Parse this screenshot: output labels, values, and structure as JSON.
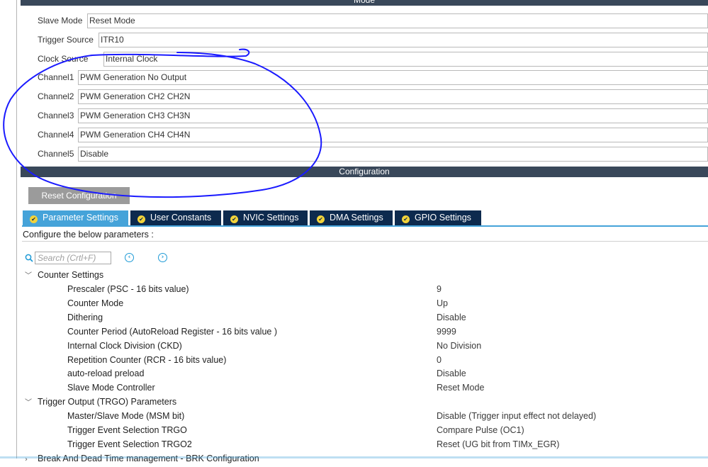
{
  "mode": {
    "header": "Mode",
    "rows": [
      {
        "label": "Slave Mode",
        "value": "Reset Mode"
      },
      {
        "label": "Trigger Source",
        "value": "ITR10"
      },
      {
        "label": "Clock Source",
        "value": "Internal Clock"
      },
      {
        "label": "Channel1",
        "value": "PWM Generation No Output"
      },
      {
        "label": "Channel2",
        "value": "PWM Generation CH2 CH2N"
      },
      {
        "label": "Channel3",
        "value": "PWM Generation CH3 CH3N"
      },
      {
        "label": "Channel4",
        "value": "PWM Generation CH4 CH4N"
      },
      {
        "label": "Channel5",
        "value": "Disable"
      }
    ]
  },
  "configuration": {
    "header": "Configuration",
    "reset_button": "Reset Configuration",
    "tabs": [
      {
        "label": "Parameter Settings",
        "active": true
      },
      {
        "label": "User Constants",
        "active": false
      },
      {
        "label": "NVIC Settings",
        "active": false
      },
      {
        "label": "DMA Settings",
        "active": false
      },
      {
        "label": "GPIO Settings",
        "active": false
      }
    ],
    "configure_text": "Configure the below parameters :",
    "search_placeholder": "Search (Crtl+F)",
    "groups": [
      {
        "label": "Counter Settings",
        "params": [
          {
            "name": "Prescaler (PSC - 16 bits value)",
            "value": "9"
          },
          {
            "name": "Counter Mode",
            "value": "Up"
          },
          {
            "name": "Dithering",
            "value": "Disable"
          },
          {
            "name": "Counter Period (AutoReload Register - 16 bits value )",
            "value": "9999"
          },
          {
            "name": "Internal Clock Division (CKD)",
            "value": "No Division"
          },
          {
            "name": "Repetition Counter (RCR - 16 bits value)",
            "value": "0"
          },
          {
            "name": "auto-reload preload",
            "value": "Disable"
          },
          {
            "name": "Slave Mode Controller",
            "value": "Reset Mode"
          }
        ]
      },
      {
        "label": "Trigger Output (TRGO) Parameters",
        "params": [
          {
            "name": "Master/Slave Mode (MSM bit)",
            "value": "Disable (Trigger input effect not delayed)"
          },
          {
            "name": "Trigger Event Selection TRGO",
            "value": "Compare Pulse (OC1)"
          },
          {
            "name": "Trigger Event Selection TRGO2",
            "value": "Reset (UG bit from TIMx_EGR)"
          }
        ]
      },
      {
        "label": "Break And Dead Time management - BRK Configuration",
        "params": []
      }
    ]
  },
  "colors": {
    "header_bg": "#39485a",
    "tab_bg": "#0d2a4e",
    "tab_active_bg": "#45a3d9",
    "annotation_ink": "#1a1aff"
  },
  "icons": {
    "tab_status": "check-circle-icon",
    "search": "search-icon",
    "nav_prev": "chevron-left-circle-icon",
    "nav_next": "chevron-right-circle-icon",
    "group_toggle": "chevron-down-icon"
  }
}
